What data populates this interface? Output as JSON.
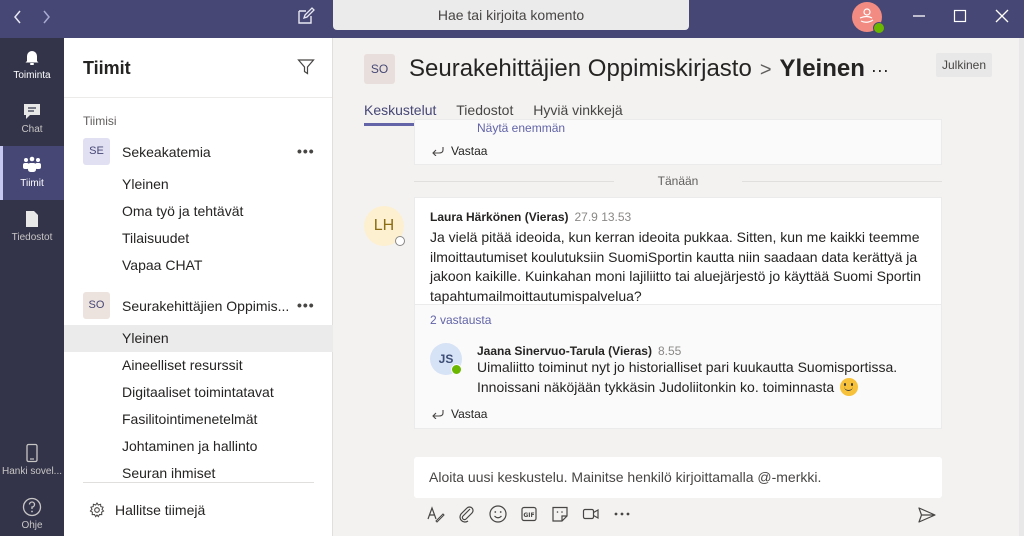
{
  "titlebar": {
    "search_placeholder": "Hae tai kirjoita komento",
    "back_icon": "chevron-left-icon",
    "forward_icon": "chevron-right-icon",
    "compose_icon": "compose-icon"
  },
  "rail": {
    "items": [
      {
        "label": "Toiminta",
        "icon": "bell-icon"
      },
      {
        "label": "Chat",
        "icon": "chat-icon"
      },
      {
        "label": "Tiimit",
        "icon": "teams-icon",
        "active": true
      },
      {
        "label": "Tiedostot",
        "icon": "file-icon"
      },
      {
        "label": "Hanki sovel...",
        "icon": "mobile-icon"
      },
      {
        "label": "Ohje",
        "icon": "help-icon"
      }
    ]
  },
  "teams_pane": {
    "title": "Tiimit",
    "section_label": "Tiimisi",
    "teams": [
      {
        "initials": "SE",
        "name": "Sekeakatemia",
        "tile_color": "#e1e0f2",
        "channels": [
          "Yleinen",
          "Oma työ ja tehtävät",
          "Tilaisuudet",
          "Vapaa CHAT"
        ]
      },
      {
        "initials": "SO",
        "name": "Seurakehittäjien Oppimis...",
        "tile_color": "#ece2de",
        "channels": [
          "Yleinen",
          "Aineelliset resurssit",
          "Digitaaliset toimintatavat",
          "Fasilitointimenetelmät",
          "Johtaminen ja hallinto",
          "Seuran ihmiset"
        ],
        "active_channel": "Yleinen"
      }
    ],
    "manage_label": "Hallitse tiimejä"
  },
  "channel_header": {
    "team_initials": "SO",
    "team_name": "Seurakehittäjien Oppimiskirjasto",
    "separator": ">",
    "channel_name": "Yleinen",
    "more": "···",
    "badge": "Julkinen",
    "tabs": [
      {
        "label": "Keskustelut",
        "active": true
      },
      {
        "label": "Tiedostot"
      },
      {
        "label": "Hyviä vinkkejä"
      }
    ]
  },
  "conversation": {
    "previous_card": {
      "show_more": "Näytä enemmän",
      "reply_label": "Vastaa"
    },
    "date_divider": "Tänään",
    "thread": {
      "author_initials": "LH",
      "author": "Laura Härkönen (Vieras)",
      "timestamp": "27.9 13.53",
      "message": "Ja vielä pitää ideoida, kun kerran ideoita pukkaa. Sitten, kun me kaikki teemme ilmoittautumiset koulutuksiin SuomiSportin kautta niin saadaan data kerättyä ja jakoon kaikille. Kuinkahan moni lajiliitto tai aluejärjestö jo käyttää Suomi Sportin tapahtumailmoittautumispalvelua?",
      "replies_count_label": "2 vastausta",
      "reply": {
        "author_initials": "JS",
        "author": "Jaana Sinervuo-Tarula (Vieras)",
        "timestamp": "8.55",
        "message": "Uimaliitto toiminut nyt jo historialliset pari kuukautta Suomisportissa. Innoissani näköjään tykkäsin Judoliitonkin ko. toiminnasta",
        "emoji": "smile-emoji"
      },
      "reply_label": "Vastaa"
    }
  },
  "composer": {
    "placeholder": "Aloita uusi keskustelu. Mainitse henkilö kirjoittamalla @-merkki.",
    "tools": [
      "format-icon",
      "attach-icon",
      "emoji-icon",
      "gif-icon",
      "sticker-icon",
      "meet-now-icon",
      "more-icon"
    ],
    "send_icon": "send-icon"
  },
  "colors": {
    "brand": "#464775",
    "accent": "#6264a7",
    "rail": "#33344a",
    "presence_available": "#6bb700",
    "user_avatar": "#f28b82"
  }
}
